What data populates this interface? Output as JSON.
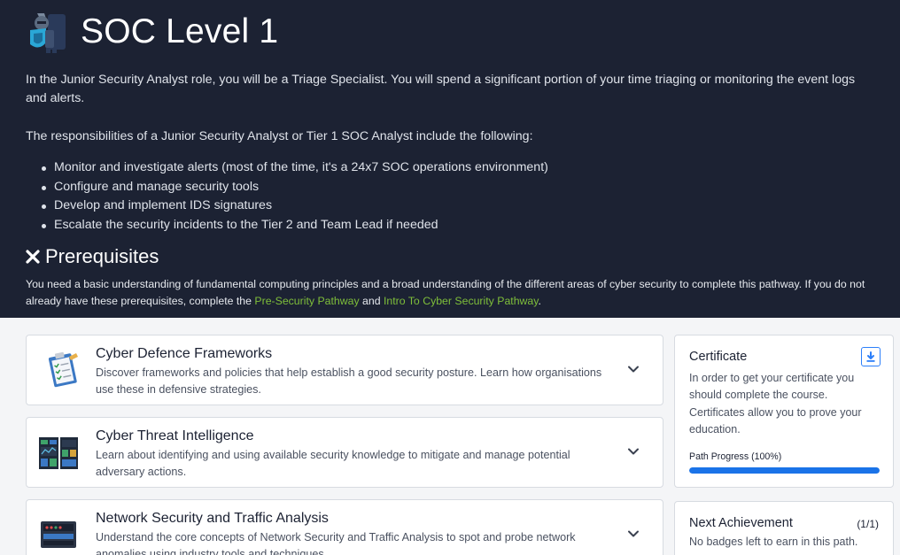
{
  "header": {
    "title": "SOC Level 1",
    "intro": "In the Junior Security Analyst role, you will be a Triage Specialist. You will spend a significant portion of your time triaging or monitoring the event logs and alerts.",
    "responsibilities_intro": "The responsibilities of a Junior Security Analyst or Tier 1 SOC Analyst include the following:",
    "responsibilities": [
      "Monitor and investigate alerts (most of the time, it's a 24x7 SOC operations environment)",
      "Configure and manage security tools",
      "Develop and implement IDS signatures",
      "Escalate the security incidents to the Tier 2 and Team Lead if needed"
    ]
  },
  "prerequisites": {
    "title": "Prerequisites",
    "text_before": "You need a basic understanding of fundamental computing principles and a broad understanding of the different areas of cyber security to complete this pathway. If you do not already have these prerequisites, complete the ",
    "link1": "Pre-Security Pathway",
    "text_middle": " and ",
    "link2": "Intro To Cyber Security Pathway",
    "text_after": "."
  },
  "modules": [
    {
      "title": "Cyber Defence Frameworks",
      "description": "Discover frameworks and policies that help establish a good security posture. Learn how organisations use these in defensive strategies.",
      "icon": "clipboard-checklist-icon"
    },
    {
      "title": "Cyber Threat Intelligence",
      "description": "Learn about identifying and using available security knowledge to mitigate and manage potential adversary actions.",
      "icon": "threat-dashboard-icon"
    },
    {
      "title": "Network Security and Traffic Analysis",
      "description": "Understand the core concepts of Network Security and Traffic Analysis to spot and probe network anomalies using industry tools and techniques.",
      "icon": "network-device-icon"
    }
  ],
  "certificate": {
    "title": "Certificate",
    "text": "In order to get your certificate you should complete the course. Certificates allow you to prove your education.",
    "progress_label": "Path Progress (100%)",
    "progress": 1.0,
    "icon": "download-icon"
  },
  "achievement": {
    "title": "Next Achievement",
    "count": "(1/1)",
    "text": "No badges left to earn in this path."
  },
  "colors": {
    "hero_bg": "#1c2233",
    "link_green": "#7fbf3a",
    "progress_blue": "#1a73e8"
  }
}
